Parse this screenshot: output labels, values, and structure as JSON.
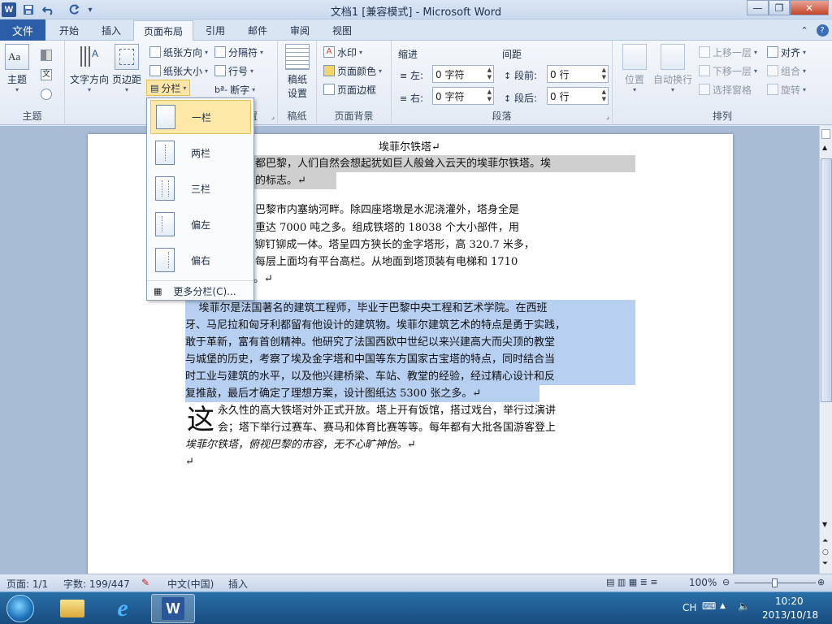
{
  "window": {
    "title": "文档1 [兼容模式] - Microsoft Word",
    "app_icon": "W",
    "controls": [
      "—",
      "❐",
      "✕"
    ]
  },
  "quick_access": [
    "save-icon",
    "undo-icon",
    "redo-icon",
    "customize-icon"
  ],
  "tabs": {
    "file": "文件",
    "items": [
      "开始",
      "插入",
      "页面布局",
      "引用",
      "邮件",
      "审阅",
      "视图"
    ],
    "active": "页面布局"
  },
  "ribbon": {
    "theme_group": {
      "label": "主题",
      "theme_btn": "主题",
      "themes_icon_text": "Aa",
      "text_label": "文"
    },
    "page_setup": {
      "label": "页面设置",
      "text_dir": "文字方向",
      "margins": "页边距",
      "orientation": "纸张方向",
      "size": "纸张大小",
      "columns": "分栏",
      "breaks": "分隔符",
      "line_numbers": "行号",
      "hyphenation": "断字"
    },
    "draft_group": {
      "label": "稿纸",
      "btn": "稿纸设置",
      "btn_line1": "稿纸",
      "btn_line2": "设置"
    },
    "background": {
      "label": "页面背景",
      "watermark": "水印",
      "page_color": "页面颜色",
      "page_border": "页面边框"
    },
    "paragraph": {
      "label": "段落",
      "indent": "缩进",
      "spacing": "间距",
      "left_label": "左:",
      "right_label": "右:",
      "before_label": "段前:",
      "after_label": "段后:",
      "left_val": "0 字符",
      "right_val": "0 字符",
      "before_val": "0 行",
      "after_val": "0 行"
    },
    "arrange": {
      "label": "排列",
      "position": "位置",
      "wrap": "自动换行",
      "bring_forward": "上移一层",
      "send_backward": "下移一层",
      "selection_pane": "选择窗格",
      "align": "对齐",
      "group": "组合",
      "rotate": "旋转"
    }
  },
  "columns_menu": {
    "items": [
      "一栏",
      "两栏",
      "三栏",
      "偏左",
      "偏右"
    ],
    "more": "更多分栏(C)...",
    "selected": "一栏"
  },
  "document": {
    "title": "埃菲尔铁塔↵",
    "lines": [
      "国首都巴黎，人们自然会想起犹如巨人般耸入云天的埃菲尔铁塔。埃",
      "巴黎的标志。↵",
      "建在巴黎市内塞纳河畔。除四座塔墩是水泥浇灌外，塔身全是",
      "构，重达 7000 吨之多。组成铁塔的 18038 个大小部件，用",
      "6 个铆钉铆成一体。塔呈四方狭长的金字塔形，高 320.7 米多，",
      "层，每层上面均有平台高栏。从地面到塔顶装有电梯和 1710",
      "。↵",
      "    埃菲尔是法国著名的建筑工程师，毕业于巴黎中央工程和艺术学院。在西班",
      "牙、马尼拉和匈牙利都留有他设计的建筑物。埃菲尔建筑艺术的特点是勇于实践，",
      "敢于革新，富有首创精神。他研究了法国西欧中世纪以来兴建高大而尖顶的教堂",
      "与城堡的历史，考察了埃及金字塔和中国等东方国家古宝塔的特点，同时结合当",
      "时工业与建筑的水平，以及他兴建桥梁、车站、教堂的经验，经过精心设计和反",
      "复推敲，最后才确定了理想方案，设计图纸达 5300 张之多。↵",
      "永久性的高大铁塔对外正式开放。塔上开有饭馆，搭过戏台，举行过演讲",
      "会；塔下举行过赛车、赛马和体育比赛等等。每年都有大批各国游客登上",
      "埃菲尔铁塔，俯视巴黎的市容，无不心旷神怡。↵",
      "↵"
    ],
    "drop_cap": "这"
  },
  "status": {
    "page": "页面: 1/1",
    "words": "字数: 199/447",
    "lang": "中文(中国)",
    "mode": "插入",
    "zoom": "100%"
  },
  "taskbar": {
    "ime": "CH",
    "time": "10:20",
    "date": "2013/10/18"
  }
}
